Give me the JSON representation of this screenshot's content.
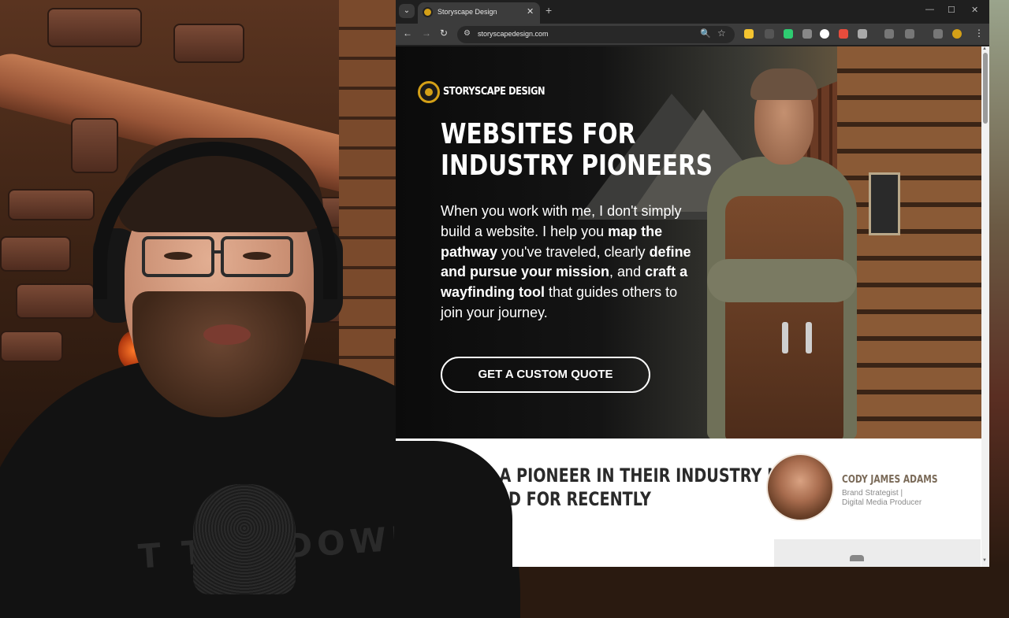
{
  "browser": {
    "tab_title": "Storyscape Design",
    "tab_close": "✕",
    "tab_new": "+",
    "tab_menu": "⌄",
    "url": "storyscapedesign.com",
    "win_min": "—",
    "win_max": "☐",
    "win_close": "✕",
    "back": "←",
    "forward": "→",
    "reload": "↻",
    "site_info": "⚙",
    "zoom": "🔍",
    "bookmark": "☆",
    "menu": "⋮",
    "accent": "#d4a017"
  },
  "hero": {
    "brand_name": "STORYSCAPE DESIGN",
    "headline_line1": "WEBSITES FOR",
    "headline_line2": "INDUSTRY PIONEERS",
    "lede_1": "When you work with me, I don't simply build a website. I help you ",
    "lede_b1": "map the pathway",
    "lede_2": " you've traveled, clearly ",
    "lede_b2": "define and pursue your mission",
    "lede_3": ", and ",
    "lede_b3": "craft a wayfinding tool",
    "lede_4": " that guides others to join your journey.",
    "cta_label": "GET A CUSTOM QUOTE"
  },
  "featured": {
    "title_line1": "HERE'S A PIONEER IN THEIR INDUSTRY I",
    "title_line2": "DESIGNED FOR RECENTLY",
    "author_name": "CODY JAMES ADAMS",
    "author_role_1": "Brand Strategist |",
    "author_role_2": "Digital Media Producer"
  },
  "webcam": {
    "shirt_text": "T THE DOWN"
  }
}
